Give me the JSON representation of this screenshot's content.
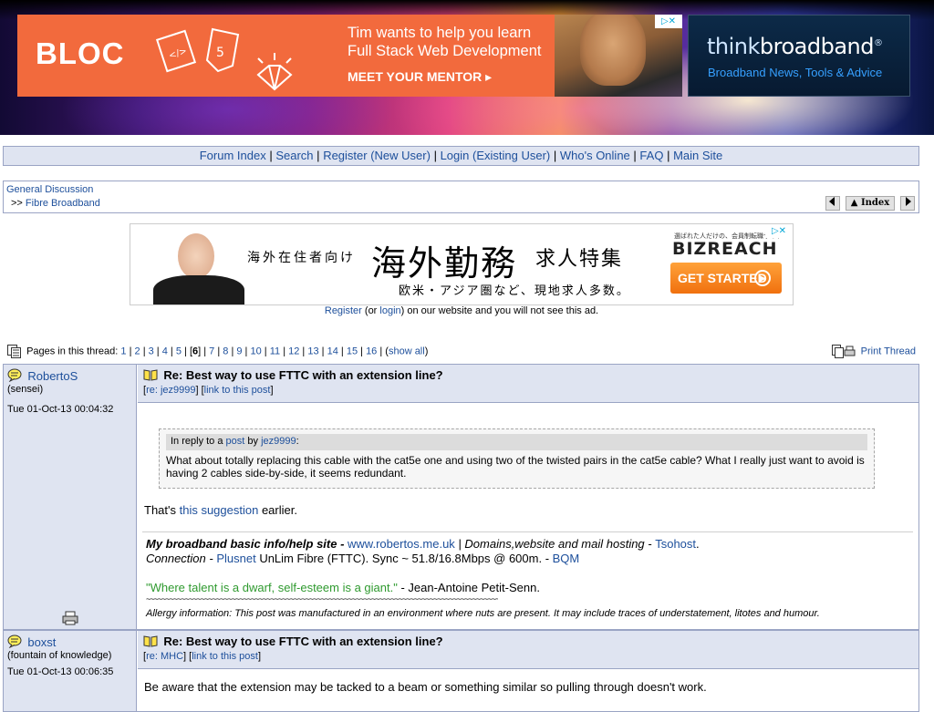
{
  "ads": {
    "top_left": {
      "brand": "BLOC",
      "headline_1": "Tim wants to help you learn",
      "headline_2": "Full Stack Web Development",
      "cta": "MEET YOUR MENTOR ▸"
    },
    "top_right": {
      "logo_thin": "think",
      "logo_bold": "broadband",
      "logo_reg": "®",
      "tagline": "Broadband News, Tools & Advice"
    },
    "middle": {
      "small_text": "海外在住者向け",
      "big_text": "海外勤務",
      "kyuujin": "求人特集",
      "subtext": "欧米・アジア圏など、現地求人多数。",
      "biz_small": "選ばれた人だけの、会員制転職サイト",
      "biz_logo": "BIZREACH",
      "biz_button": "GET STARTED"
    },
    "adchoice_label": "▷✕"
  },
  "nav": {
    "links": [
      "Forum Index",
      "Search",
      "Register (New User)",
      "Login (Existing User)",
      "Who's Online",
      "FAQ",
      "Main Site"
    ],
    "separator": "|"
  },
  "breadcrumb": {
    "level1": "General Discussion",
    "prefix": ">>",
    "level2": "Fibre Broadband",
    "index_button": "▲ Index"
  },
  "register_note": {
    "register": "Register",
    "middle": " (or ",
    "login": "login",
    "tail": ") on our website and you will not see this ad."
  },
  "pagination": {
    "label": "Pages in this thread: ",
    "pages": [
      "1",
      "2",
      "3",
      "4",
      "5",
      "6",
      "7",
      "8",
      "9",
      "10",
      "11",
      "12",
      "13",
      "14",
      "15",
      "16"
    ],
    "current": "6",
    "show_all": "show all",
    "print": "Print Thread"
  },
  "posts": [
    {
      "author": "RobertoS",
      "role": "(sensei)",
      "date": "Tue 01-Oct-13 00:04:32",
      "subject": "Re: Best way to use FTTC with an extension line?",
      "reply_to": "re: jez9999",
      "permalink": "link to this post",
      "quote": {
        "prefix": "In reply to a ",
        "post_link": "post",
        "by": " by ",
        "author": "jez9999",
        "colon": ":",
        "text": "What about totally replacing this cable with the cat5e one and using two of the twisted pairs in the cat5e cable? What I really just want to avoid is having 2 cables side-by-side, it seems redundant."
      },
      "body_prefix": "That's ",
      "body_link": "this suggestion",
      "body_suffix": " earlier.",
      "signature": {
        "line1_bold": "My broadband basic info/help site - ",
        "line1_link": "www.robertos.me.uk",
        "line1_mid": " | Domains,website and mail hosting - ",
        "line1_link2": "Tsohost",
        "line1_end": ".",
        "line2_a": "Connection - ",
        "line2_isp": "Plusnet",
        "line2_b": " UnLim Fibre (FTTC). Sync ~ 51.8/16.8Mbps @ 600m. - ",
        "line2_bqm": "BQM",
        "quote": "\"Where talent is a dwarf, self-esteem is a giant.\"",
        "quote_author": " - Jean-Antoine Petit-Senn.",
        "tilde": "~~~~~~~~~~~~~~~~~~~~~~~~~~~~~~~~~~~~~~~~~~~~~~~~~~~~~~~~~~~~~~~~~~~~~~~~~~~~~~~~~~~~~~~~~~~~~~~~~~~~~~~~~~~~~~",
        "allergy": "Allergy information: This post was manufactured in an environment where nuts are present. It may include traces of understatement, litotes and humour."
      }
    },
    {
      "author": "boxst",
      "role": "(fountain of knowledge)",
      "date": "Tue 01-Oct-13 00:06:35",
      "subject": "Re: Best way to use FTTC with an extension line?",
      "reply_to": "re: MHC",
      "permalink": "link to this post",
      "body": "Be aware that the extension may be tacked to a beam or something similar so pulling through doesn't work."
    }
  ],
  "colors": {
    "link": "#1d4f9b",
    "panel": "#dfe4f1",
    "border": "#9aa4c4",
    "ad_orange": "#f26a3d",
    "sig_green": "#2f9a2f"
  }
}
